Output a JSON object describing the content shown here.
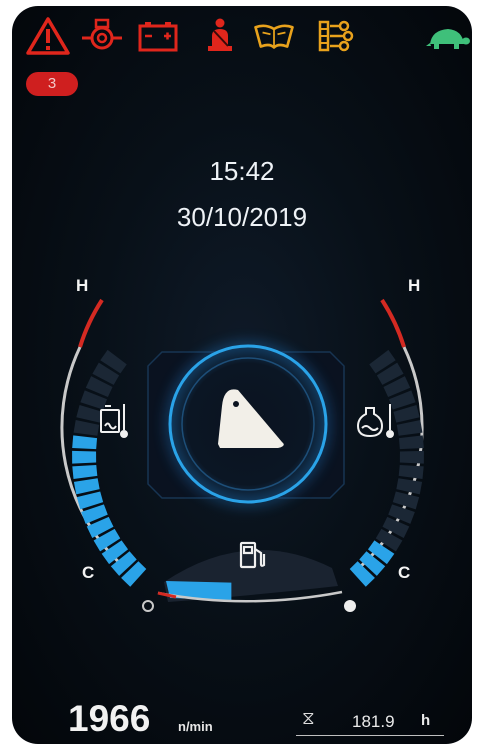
{
  "warning_lights": [
    {
      "name": "general-warning-icon",
      "color": "#e0261c"
    },
    {
      "name": "oil-pressure-icon",
      "color": "#e0261c"
    },
    {
      "name": "battery-icon",
      "color": "#e0261c"
    },
    {
      "name": "seatbelt-icon",
      "color": "#e0261c"
    },
    {
      "name": "manual-book-icon",
      "color": "#e8a21c"
    },
    {
      "name": "air-filter-icon",
      "color": "#e8a21c"
    },
    {
      "name": "turtle-slow-mode-icon",
      "color": "#3fc07a"
    }
  ],
  "alert_count": "3",
  "clock": {
    "time": "15:42",
    "date": "30/10/2019"
  },
  "left_gauge": {
    "icon": "hydraulic-oil-temperature-icon",
    "high_label": "H",
    "low_label": "C",
    "level": 0.62,
    "segments": 17
  },
  "right_gauge": {
    "icon": "coolant-temperature-icon",
    "high_label": "H",
    "low_label": "C",
    "level": 0.2,
    "segments": 17
  },
  "fuel_gauge": {
    "icon": "fuel-pump-icon",
    "level": 0.38
  },
  "mode_icon": "bucket-work-mode-icon",
  "engine_speed": {
    "value": "1966",
    "unit": "n/min"
  },
  "hour_meter": {
    "icon": "hourglass-icon",
    "symbol": "⧖",
    "value": "181.9",
    "unit": "h"
  },
  "colors": {
    "accent": "#2aa3e8",
    "red": "#d42a22",
    "amber": "#e8a21c",
    "green": "#3fc07a"
  }
}
